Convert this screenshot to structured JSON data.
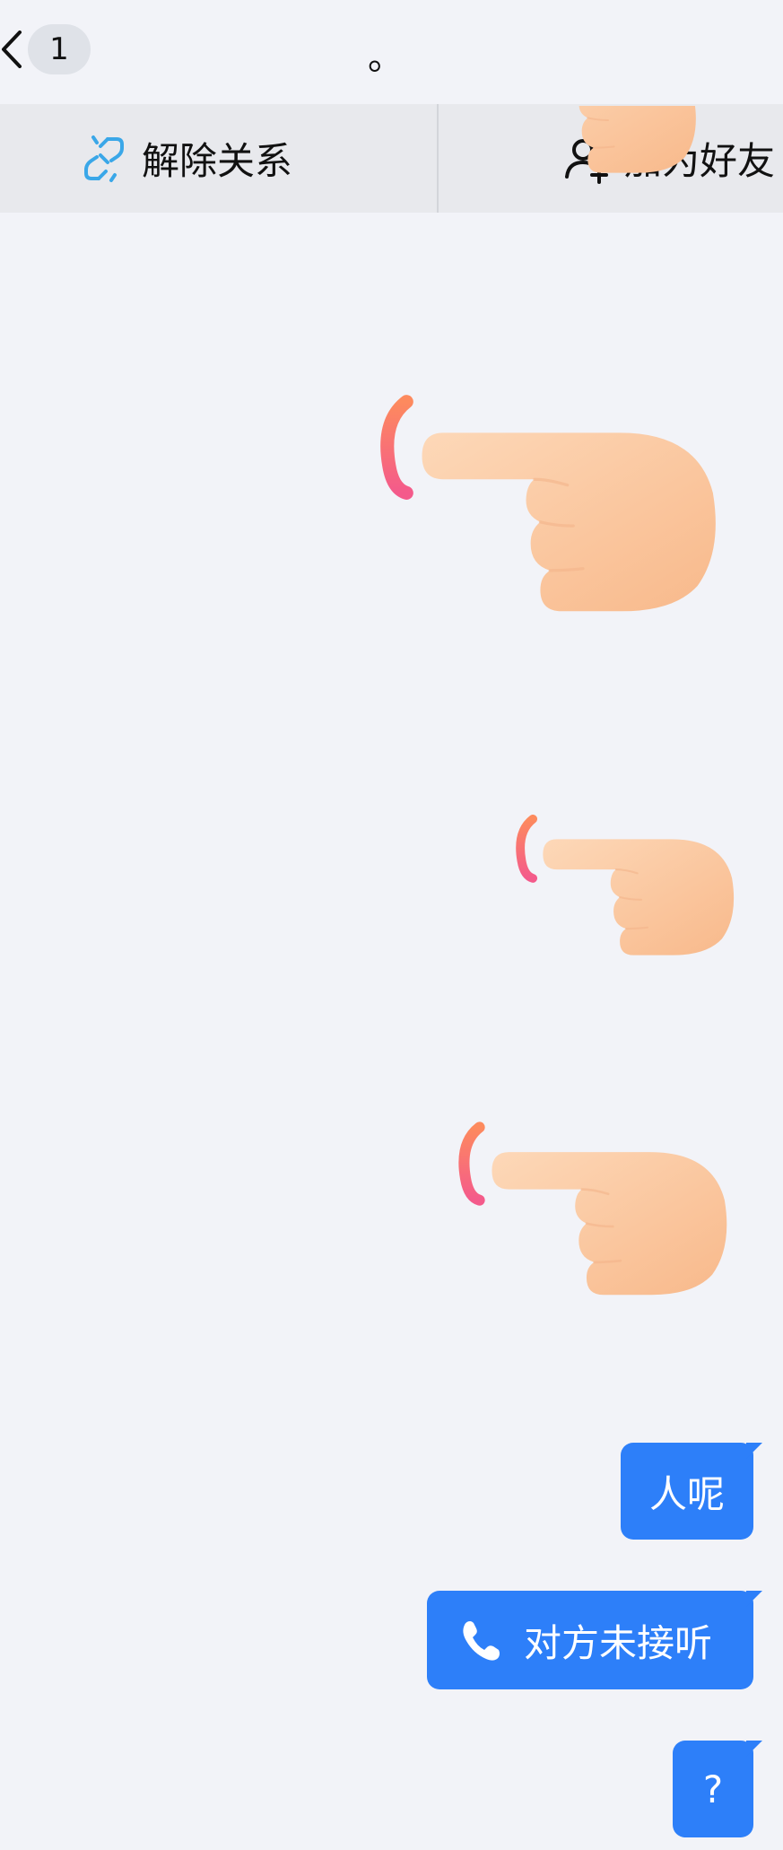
{
  "header": {
    "unread_count": "1",
    "title": "。"
  },
  "actions": {
    "unbind_label": "解除关系",
    "add_friend_label": "加为好友"
  },
  "messages": [
    {
      "type": "sticker",
      "emoji": "pointing-left-hand"
    },
    {
      "type": "sticker",
      "emoji": "pointing-left-hand"
    },
    {
      "type": "sticker",
      "emoji": "pointing-left-hand"
    },
    {
      "type": "sticker",
      "emoji": "pointing-left-hand"
    },
    {
      "type": "text",
      "text": "人呢"
    },
    {
      "type": "call",
      "text": "对方未接听",
      "icon": "phone-icon"
    },
    {
      "type": "text",
      "text": "?"
    }
  ],
  "colors": {
    "bubble": "#2d7ff9",
    "background": "#f2f3f8",
    "action_bar": "#e8e9ed"
  }
}
